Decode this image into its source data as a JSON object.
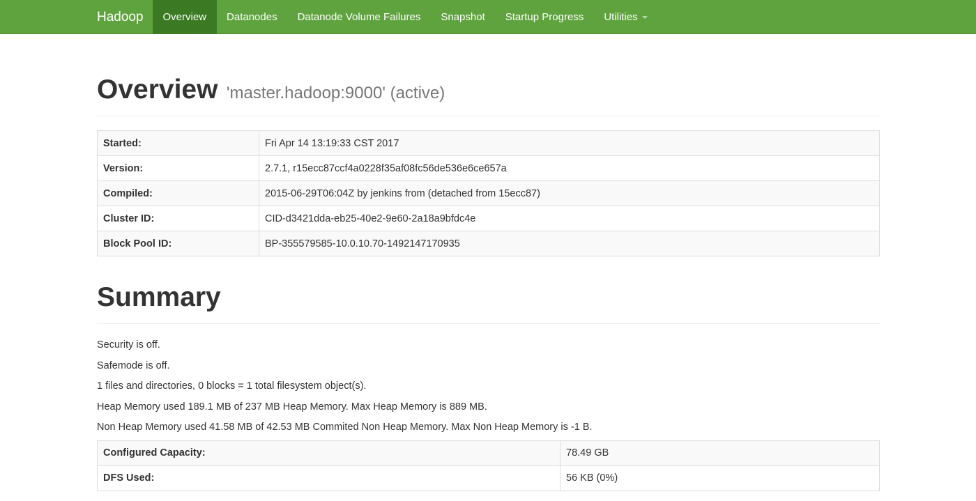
{
  "navbar": {
    "brand": "Hadoop",
    "items": [
      {
        "label": "Overview",
        "active": true
      },
      {
        "label": "Datanodes",
        "active": false
      },
      {
        "label": "Datanode Volume Failures",
        "active": false
      },
      {
        "label": "Snapshot",
        "active": false
      },
      {
        "label": "Startup Progress",
        "active": false
      },
      {
        "label": "Utilities",
        "active": false
      }
    ],
    "color": "#5fa33e",
    "active_color": "#3b7a23"
  },
  "overview": {
    "title": "Overview",
    "subtitle": "'master.hadoop:9000' (active)",
    "rows": [
      {
        "label": "Started:",
        "value": "Fri Apr 14 13:19:33 CST 2017"
      },
      {
        "label": "Version:",
        "value": "2.7.1, r15ecc87ccf4a0228f35af08fc56de536e6ce657a"
      },
      {
        "label": "Compiled:",
        "value": "2015-06-29T06:04Z by jenkins from (detached from 15ecc87)"
      },
      {
        "label": "Cluster ID:",
        "value": "CID-d3421dda-eb25-40e2-9e60-2a18a9bfdc4e"
      },
      {
        "label": "Block Pool ID:",
        "value": "BP-355579585-10.0.10.70-1492147170935"
      }
    ]
  },
  "summary": {
    "title": "Summary",
    "lines": [
      "Security is off.",
      "Safemode is off.",
      "1 files and directories, 0 blocks = 1 total filesystem object(s).",
      "Heap Memory used 189.1 MB of 237 MB Heap Memory. Max Heap Memory is 889 MB.",
      "Non Heap Memory used 41.58 MB of 42.53 MB Commited Non Heap Memory. Max Non Heap Memory is -1 B."
    ],
    "rows": [
      {
        "label": "Configured Capacity:",
        "value": "78.49 GB"
      },
      {
        "label": "DFS Used:",
        "value": "56 KB (0%)"
      }
    ]
  }
}
